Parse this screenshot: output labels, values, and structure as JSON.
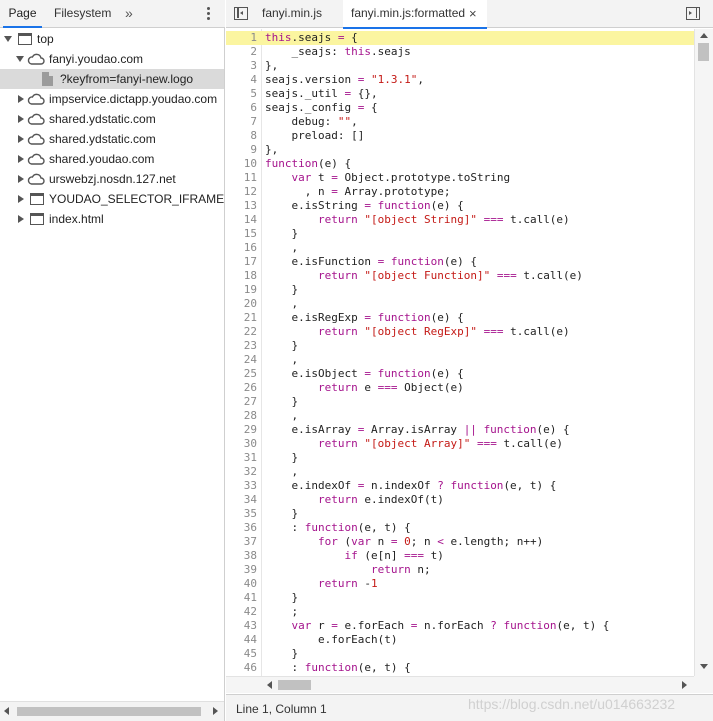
{
  "navigator": {
    "tabs": {
      "page": "Page",
      "filesystem": "Filesystem",
      "more": "»"
    },
    "tree": [
      {
        "label": "top",
        "icon": "frame-icon",
        "expanded": true
      },
      {
        "label": "fanyi.youdao.com",
        "icon": "cloud-icon",
        "expanded": true
      },
      {
        "label": "?keyfrom=fanyi-new.logo",
        "icon": "file-icon",
        "selected": true
      },
      {
        "label": "impservice.dictapp.youdao.com",
        "icon": "cloud-icon"
      },
      {
        "label": "shared.ydstatic.com",
        "icon": "cloud-icon"
      },
      {
        "label": "shared.ydstatic.com",
        "icon": "cloud-icon"
      },
      {
        "label": "shared.youdao.com",
        "icon": "cloud-icon"
      },
      {
        "label": "urswebzj.nosdn.127.net",
        "icon": "cloud-icon"
      },
      {
        "label": "YOUDAO_SELECTOR_IFRAME (abc",
        "icon": "frame-icon"
      },
      {
        "label": "index.html",
        "icon": "frame-icon"
      }
    ]
  },
  "editor": {
    "tabs": {
      "minified": "fanyi.min.js",
      "formatted": "fanyi.min.js:formatted",
      "close": "×"
    },
    "lines": [
      "this.seajs = {",
      "    _seajs: this.seajs",
      "},",
      "seajs.version = \"1.3.1\",",
      "seajs._util = {},",
      "seajs._config = {",
      "    debug: \"\",",
      "    preload: []",
      "},",
      "function(e) {",
      "    var t = Object.prototype.toString",
      "      , n = Array.prototype;",
      "    e.isString = function(e) {",
      "        return \"[object String]\" === t.call(e)",
      "    }",
      "    ,",
      "    e.isFunction = function(e) {",
      "        return \"[object Function]\" === t.call(e)",
      "    }",
      "    ,",
      "    e.isRegExp = function(e) {",
      "        return \"[object RegExp]\" === t.call(e)",
      "    }",
      "    ,",
      "    e.isObject = function(e) {",
      "        return e === Object(e)",
      "    }",
      "    ,",
      "    e.isArray = Array.isArray || function(e) {",
      "        return \"[object Array]\" === t.call(e)",
      "    }",
      "    ,",
      "    e.indexOf = n.indexOf ? function(e, t) {",
      "        return e.indexOf(t)",
      "    }",
      "    : function(e, t) {",
      "        for (var n = 0; n < e.length; n++)",
      "            if (e[n] === t)",
      "                return n;",
      "        return -1",
      "    }",
      "    ;",
      "    var r = e.forEach = n.forEach ? function(e, t) {",
      "        e.forEach(t)",
      "    }",
      "    : function(e, t) {",
      "        "
    ],
    "highlighted_line": 1
  },
  "status": {
    "cursor": "Line 1, Column 1",
    "watermark": "https://blog.csdn.net/u014663232"
  },
  "colors": {
    "keyword": "#a5148d",
    "string": "#c41a16",
    "highlight": "#fbf5a0",
    "accent": "#1a73e8"
  }
}
